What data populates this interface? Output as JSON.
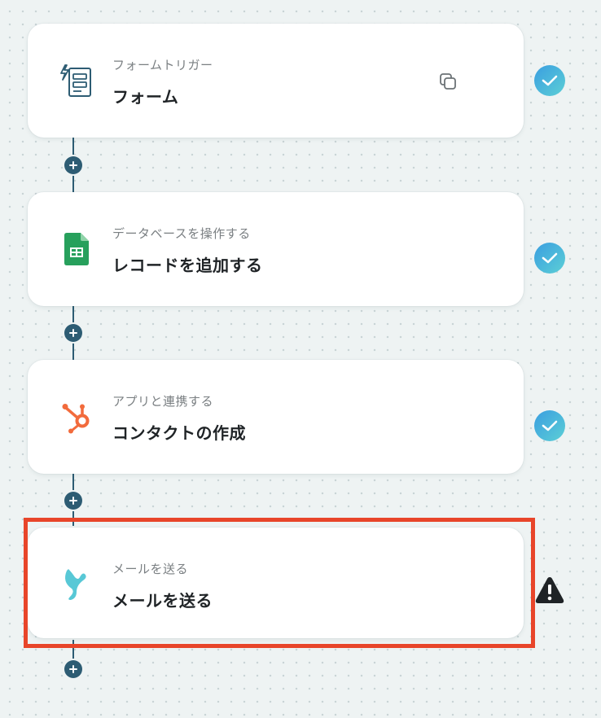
{
  "steps": [
    {
      "subtitle": "フォームトリガー",
      "title": "フォーム",
      "icon": "form-trigger-icon",
      "status": "success",
      "has_copy": true
    },
    {
      "subtitle": "データベースを操作する",
      "title": "レコードを追加する",
      "icon": "google-sheets-icon",
      "status": "success",
      "has_copy": false
    },
    {
      "subtitle": "アプリと連携する",
      "title": "コンタクトの作成",
      "icon": "hubspot-icon",
      "status": "success",
      "has_copy": false
    },
    {
      "subtitle": "メールを送る",
      "title": "メールを送る",
      "icon": "mail-app-icon",
      "status": "warning",
      "highlighted": true
    }
  ],
  "colors": {
    "connector": "#2d5c73",
    "success_gradient_start": "#3a9ee0",
    "success_gradient_end": "#5ccfd6",
    "highlight": "#e8452a",
    "sheets_green": "#27a05c",
    "hubspot_orange": "#f26b3c",
    "mail_teal": "#58c8d6"
  }
}
